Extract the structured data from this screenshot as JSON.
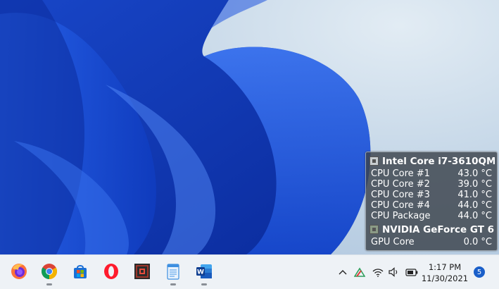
{
  "gadget": {
    "cpu_name": "Intel Core i7-3610QM",
    "cpu_rows": [
      {
        "label": "CPU Core #1",
        "value": "43.0 °C"
      },
      {
        "label": "CPU Core #2",
        "value": "39.0 °C"
      },
      {
        "label": "CPU Core #3",
        "value": "41.0 °C"
      },
      {
        "label": "CPU Core #4",
        "value": "44.0 °C"
      },
      {
        "label": "CPU Package",
        "value": "44.0 °C"
      }
    ],
    "gpu_name": "NVIDIA GeForce GT 6",
    "gpu_rows": [
      {
        "label": "GPU Core",
        "value": "0.0 °C"
      }
    ]
  },
  "taskbar": {
    "apps": [
      {
        "icon": "firefox-icon",
        "running": false
      },
      {
        "icon": "chrome-icon",
        "running": true
      },
      {
        "icon": "microsoft-store-icon",
        "running": false
      },
      {
        "icon": "opera-icon",
        "running": false
      },
      {
        "icon": "sensor-app-icon",
        "running": false
      },
      {
        "icon": "notepad-icon",
        "running": true
      },
      {
        "icon": "word-icon",
        "running": true
      }
    ],
    "tray": {
      "time": "1:17 PM",
      "date": "11/30/2021",
      "notification_count": "5",
      "icons": [
        "chevron-up-icon",
        "app-tray-icon",
        "wifi-icon",
        "volume-icon",
        "battery-icon"
      ]
    }
  }
}
